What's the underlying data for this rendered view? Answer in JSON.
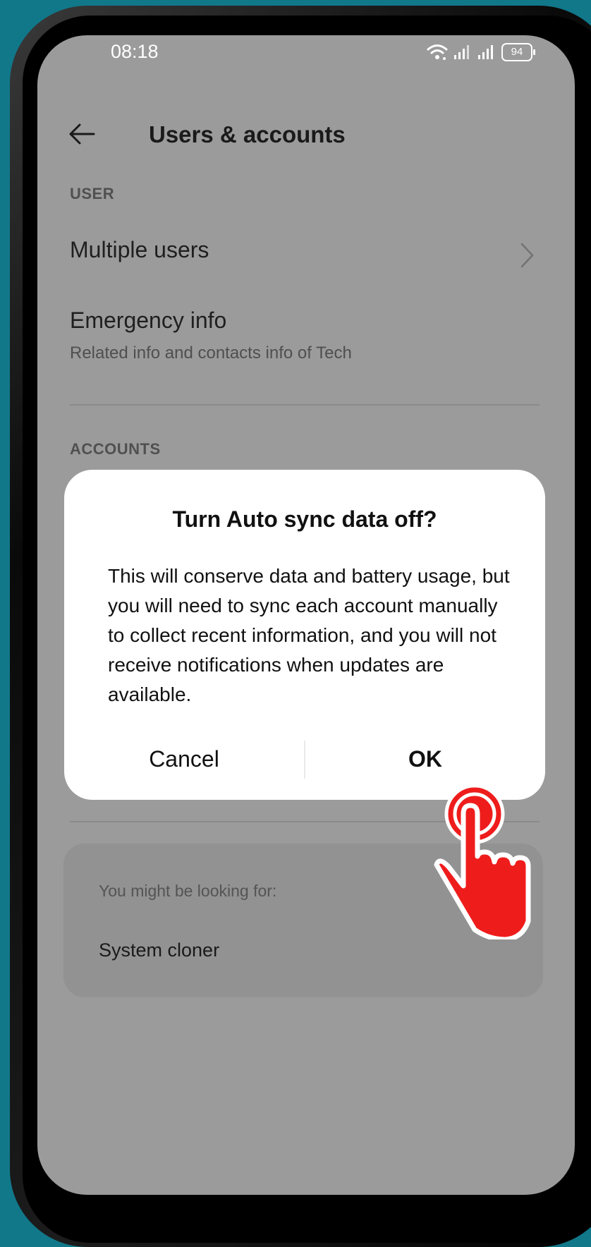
{
  "status_bar": {
    "time": "08:18",
    "battery_level": "94"
  },
  "header": {
    "title": "Users & accounts"
  },
  "sections": {
    "user_label": "USER",
    "accounts_label": "ACCOUNTS"
  },
  "items": {
    "multiple_users": {
      "title": "Multiple users"
    },
    "emergency_info": {
      "title": "Emergency info",
      "subtitle": "Related info and contacts info of Tech"
    }
  },
  "suggestions": {
    "label": "You might be looking for:",
    "items": [
      "System cloner"
    ]
  },
  "dialog": {
    "title": "Turn Auto sync data off?",
    "body": "This will conserve data and battery usage, but you will need to sync each account manually to collect recent information, and you will not receive notifications when updates are available.",
    "cancel_label": "Cancel",
    "ok_label": "OK"
  },
  "colors": {
    "background": "#11788a",
    "dimmed_screen": "#9b9b9b",
    "dialog": "#ffffff",
    "tap_indicator": "#ef1c1c"
  }
}
